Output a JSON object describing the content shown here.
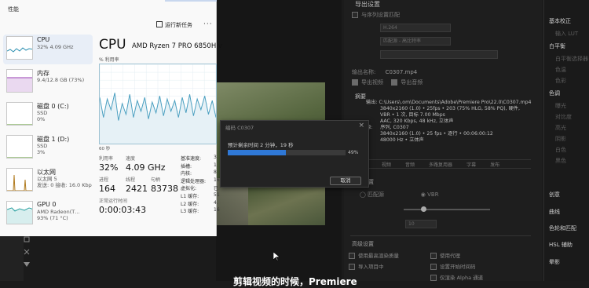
{
  "task_manager": {
    "header": "性能",
    "run_task_label": "运行新任务",
    "more_label": "···",
    "sidebar": [
      {
        "name": "CPU",
        "sub": "32% 4.09 GHz"
      },
      {
        "name": "内存",
        "sub": "9.4/12.8 GB (73%)"
      },
      {
        "name": "磁盘 0 (C:)",
        "sub": "SSD\n0%"
      },
      {
        "name": "磁盘 1 (D:)",
        "sub": "SSD\n3%"
      },
      {
        "name": "以太网",
        "sub": "以太网 5\n发送: 0 接收: 16.0 Kbp"
      },
      {
        "name": "GPU 0",
        "sub": "AMD Radeon(T…\n93% (71 °C)"
      }
    ],
    "main": {
      "title": "CPU",
      "model": "AMD Ryzen 7 PRO 6850H v",
      "util_label": "% 利用率",
      "time_label": "60 秒",
      "utilization_label": "利用率",
      "utilization_value": "32%",
      "speed_label": "速度",
      "speed_value": "4.09 GHz",
      "processes_label": "进程",
      "processes_value": "164",
      "threads_label": "线程",
      "threads_value": "2421",
      "handles_label": "句柄",
      "handles_value": "83738",
      "uptime_label": "正常运行时间",
      "uptime_value": "0:00:03:43",
      "details": [
        {
          "k": "基准速度:",
          "v": "3."
        },
        {
          "k": "插槽:",
          "v": "1"
        },
        {
          "k": "内核:",
          "v": "8"
        },
        {
          "k": "逻辑处理器:",
          "v": "16"
        },
        {
          "k": "虚拟化:",
          "v": "已"
        },
        {
          "k": "L1 缓存:",
          "v": "51"
        },
        {
          "k": "L2 缓存:",
          "v": "4."
        },
        {
          "k": "L3 缓存:",
          "v": "16"
        }
      ]
    },
    "graph_points": [
      60,
      34,
      58,
      44,
      66,
      30,
      52,
      38,
      64,
      34,
      56,
      42,
      60,
      32,
      54,
      40,
      62,
      36,
      58,
      42,
      56,
      34,
      60,
      40,
      64,
      36,
      58,
      44,
      62,
      38,
      56,
      34
    ]
  },
  "dialog": {
    "title": "编码 C0307",
    "estimate": "预计剩余时间 2 分钟，19 秒",
    "progress": 49,
    "progress_label": "49%",
    "cancel_label": "取消",
    "close_label": "×"
  },
  "export_panel": {
    "header": "导出设置",
    "output_name_label": "输出名称:",
    "output_name_value": "C0307.mp4",
    "export_video_label": "导出视频",
    "export_audio_label": "导出音频",
    "summary_label": "摘要",
    "output_label": "输出:",
    "output_lines": [
      "C:\\Users\\.om\\Documents\\Adobe\\Premiere Pro\\22.0\\C0307.mp4",
      "3840x2160 (1.0) • 25fps • 203 (75% HLG, 58% PQ), 硬件,",
      "VBR • 1 次, 目标 7.00 Mbps",
      "AAC, 320 Kbps, 48 kHz, 立体声"
    ],
    "source_label": "源:",
    "source_lines": [
      "序列, C0307",
      "3840x2160 (1.0) • 25 fps • 逐行 • 00:06:00:12",
      "48000 Hz • 立体声"
    ],
    "tabs": [
      "效果",
      "视频",
      "音频",
      "多路复用器",
      "字幕",
      "发布"
    ],
    "video_settings_label": "视频设置",
    "bottom_rows": [
      "使用最高渲染质量",
      "使用代理",
      "导入项目中",
      "设置开始时间码",
      "仅渲染 Alpha 通道"
    ]
  },
  "right_panel": {
    "items": [
      {
        "label": "基本校正",
        "bright": true
      },
      {
        "label": "输入 LUT",
        "bright": false
      },
      {
        "label": "白平衡",
        "bright": true
      },
      {
        "label": "白平衡选择器",
        "bright": false
      },
      {
        "label": "色温",
        "bright": false
      },
      {
        "label": "色彩",
        "bright": false
      },
      {
        "label": "色调",
        "bright": true
      },
      {
        "label": "曝光",
        "bright": false
      },
      {
        "label": "对比度",
        "bright": false
      },
      {
        "label": "高光",
        "bright": false
      },
      {
        "label": "阴影",
        "bright": false
      },
      {
        "label": "白色",
        "bright": false
      },
      {
        "label": "黑色",
        "bright": false
      },
      {
        "label": "创意",
        "bright": true
      },
      {
        "label": "曲线",
        "bright": true
      },
      {
        "label": "色轮和匹配",
        "bright": true
      },
      {
        "label": "HSL 辅助",
        "bright": true
      },
      {
        "label": "晕影",
        "bright": true
      }
    ]
  },
  "subtitle": "剪辑视频的时候，Premiere"
}
